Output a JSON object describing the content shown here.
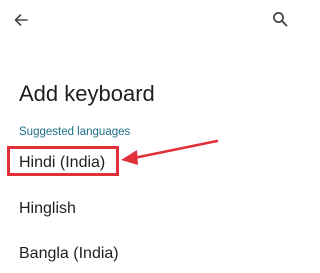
{
  "header": {
    "back_icon": "arrow-back-icon",
    "search_icon": "search-icon"
  },
  "page": {
    "title": "Add keyboard"
  },
  "section": {
    "label": "Suggested languages"
  },
  "languages": [
    {
      "label": "Hindi (India)",
      "highlighted": true
    },
    {
      "label": "Hinglish",
      "highlighted": false
    },
    {
      "label": "Bangla (India)",
      "highlighted": false
    }
  ],
  "colors": {
    "accent": "#1a6e86",
    "annotation": "#e0303a",
    "text": "#1f1f1f",
    "background": "#ffffff"
  }
}
